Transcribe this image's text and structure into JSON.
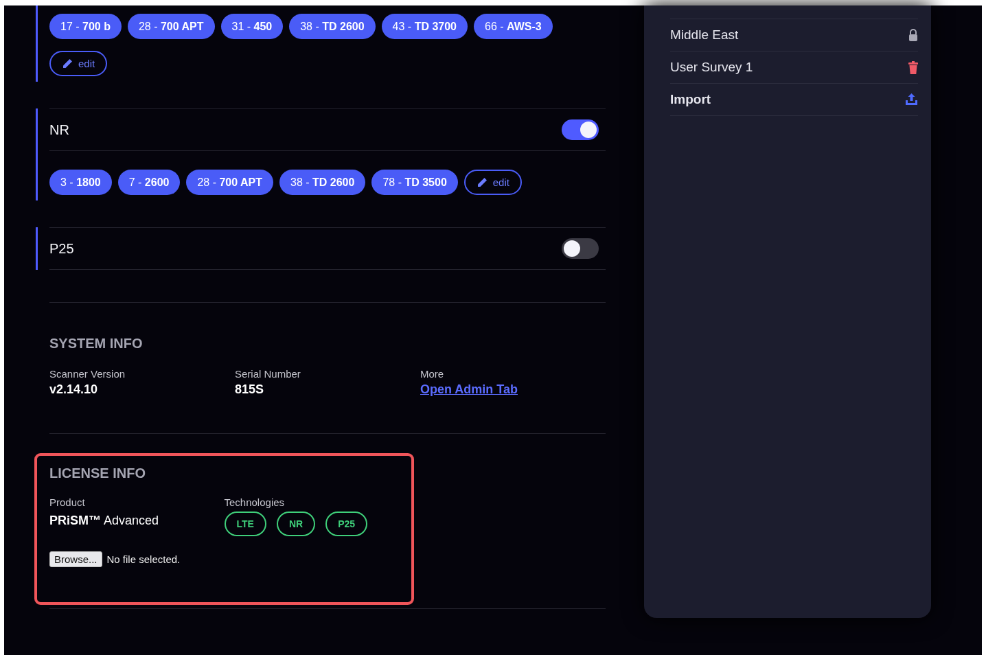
{
  "bands": [
    {
      "chips": [
        "17 - **700 b**",
        "28 - **700 APT**",
        "31 - **450**",
        "38 - **TD 2600**",
        "43 - **TD 3700**",
        "66 - **AWS-3**"
      ],
      "edit": "edit"
    },
    {
      "title": "NR",
      "on": true,
      "chips": [
        "3 - **1800**",
        "7 - **2600**",
        "28 - **700 APT**",
        "38 - **TD 2600**",
        "78 - **TD 3500**"
      ],
      "edit": "edit"
    },
    {
      "title": "P25",
      "on": false
    }
  ],
  "system_info": {
    "title": "SYSTEM INFO",
    "fields": [
      {
        "label": "Scanner Version",
        "value": "v2.14.10",
        "kind": "text"
      },
      {
        "label": "Serial Number",
        "value": "815S",
        "kind": "text"
      },
      {
        "label": "More",
        "value": "Open Admin Tab",
        "kind": "link"
      }
    ]
  },
  "license_info": {
    "title": "LICENSE INFO",
    "product_label": "Product",
    "product": "**PRiSM™** Advanced",
    "technologies_label": "Technologies",
    "technologies": [
      "LTE",
      "NR",
      "P25"
    ],
    "browse_button": "Browse...",
    "file_status": "No file selected."
  },
  "side_list": [
    {
      "label": "Middle East",
      "kind": "locked"
    },
    {
      "label": "User Survey 1",
      "kind": "deletable"
    },
    {
      "label": "Import",
      "kind": "import"
    }
  ]
}
